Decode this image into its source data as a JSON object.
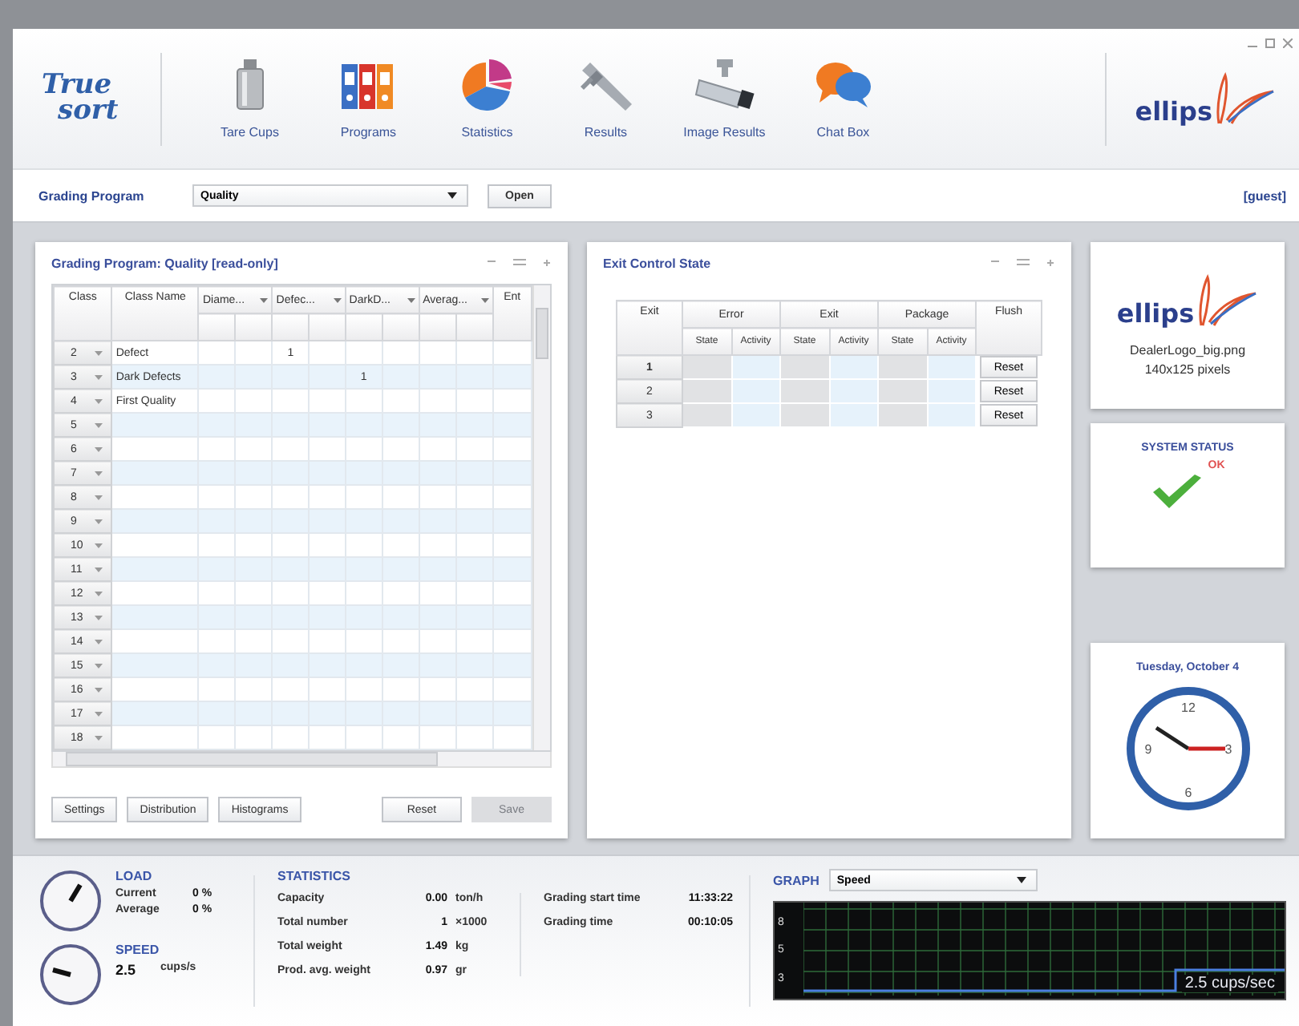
{
  "logo": {
    "line_1": "True",
    "line_2": "sort"
  },
  "toolbar": [
    {
      "label": "Tare Cups",
      "kind": "tare"
    },
    {
      "label": "Programs",
      "kind": "programs"
    },
    {
      "label": "Statistics",
      "kind": "statistics"
    },
    {
      "label": "Results",
      "kind": "results"
    },
    {
      "label": "Image Results",
      "kind": "images"
    },
    {
      "label": "Chat Box",
      "kind": "chat"
    }
  ],
  "brand": "ellips",
  "program_bar": {
    "label": "Grading Program",
    "value": "Quality",
    "open_button": "Open",
    "user": "[guest]"
  },
  "grading_panel": {
    "title": "Grading Program: Quality [read-only]",
    "columns": {
      "class": "Class",
      "name": "Class Name",
      "groups": [
        "Diame...",
        "Defec...",
        "DarkD...",
        "Averag..."
      ],
      "last": "Ent"
    },
    "rows": [
      {
        "class": "2",
        "name": "Defect",
        "defec_value": "1"
      },
      {
        "class": "3",
        "name": "Dark Defects",
        "darkd_value": "1"
      },
      {
        "class": "4",
        "name": "First Quality"
      },
      {
        "class": "5"
      },
      {
        "class": "6"
      },
      {
        "class": "7"
      },
      {
        "class": "8"
      },
      {
        "class": "9"
      },
      {
        "class": "10"
      },
      {
        "class": "11"
      },
      {
        "class": "12"
      },
      {
        "class": "13"
      },
      {
        "class": "14"
      },
      {
        "class": "15"
      },
      {
        "class": "16"
      },
      {
        "class": "17"
      },
      {
        "class": "18"
      }
    ],
    "left_buttons": [
      {
        "label": "Settings",
        "disabled": false
      },
      {
        "label": "Distribution",
        "disabled": false
      },
      {
        "label": "Histograms",
        "disabled": false
      }
    ],
    "right_buttons": [
      {
        "label": "Reset",
        "disabled": false
      },
      {
        "label": "Save",
        "disabled": true
      }
    ]
  },
  "exit_panel": {
    "title": "Exit Control State",
    "columns": {
      "exit": "Exit",
      "groups": [
        {
          "label": "Error",
          "sub": [
            "State",
            "Activity"
          ]
        },
        {
          "label": "Exit",
          "sub": [
            "State",
            "Activity"
          ]
        },
        {
          "label": "Package",
          "sub": [
            "State",
            "Activity"
          ]
        }
      ],
      "flush": "Flush"
    },
    "rows": [
      {
        "exit": "1",
        "button": "Reset"
      },
      {
        "exit": "2",
        "button": "Reset"
      },
      {
        "exit": "3",
        "button": "Reset"
      }
    ]
  },
  "dealer_logo": {
    "brand": "ellips",
    "file": "DealerLogo_big.png",
    "size": "140x125 pixels"
  },
  "system_status": {
    "title": "SYSTEM STATUS",
    "status": "OK"
  },
  "clock": {
    "date": "Tuesday, October 4",
    "numbers": [
      "12",
      "3",
      "6",
      "9"
    ]
  },
  "load": {
    "title": "LOAD",
    "rows": [
      {
        "label": "Current",
        "value": "0 %"
      },
      {
        "label": "Average",
        "value": "0 %"
      }
    ]
  },
  "speed": {
    "title": "SPEED",
    "value": "2.5",
    "unit": "cups/s"
  },
  "statistics": {
    "title": "STATISTICS",
    "rows": [
      {
        "label": "Capacity",
        "value": "0.00",
        "unit": "ton/h"
      },
      {
        "label": "Total number",
        "value": "1",
        "unit": "×1000"
      },
      {
        "label": "Total weight",
        "value": "1.49",
        "unit": "kg"
      },
      {
        "label": "Prod. avg. weight",
        "value": "0.97",
        "unit": "gr"
      }
    ],
    "times": [
      {
        "label": "Grading start time",
        "value": "11:33:22"
      },
      {
        "label": "Grading time",
        "value": "00:10:05"
      }
    ]
  },
  "graph": {
    "title": "GRAPH",
    "select": "Speed",
    "axis_labels": [
      "8",
      "5",
      "3"
    ],
    "reading": "2.5 cups/sec"
  }
}
